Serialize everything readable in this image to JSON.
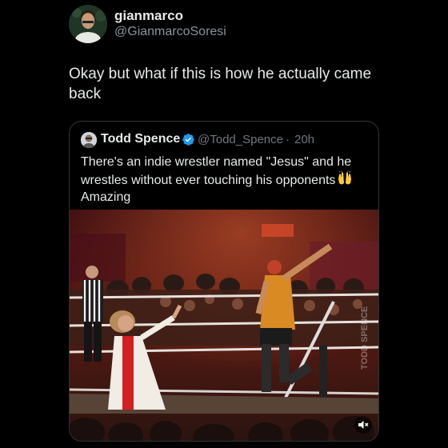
{
  "author": {
    "name": "gianmarco",
    "handle": "@GianmarcoSoresi",
    "avatar_icon": "profile-photo"
  },
  "tweet": {
    "text_line1": "Okay but what if this is how he actually came",
    "text_line2": "back"
  },
  "quote": {
    "name": "Todd Spence",
    "handle": "@Todd_Spence",
    "separator": "·",
    "time": "20h",
    "verified_color": "#1d9bf0",
    "text_line1": "There's an indie wrestler named \"Jesus\" and he",
    "text_line2": "wrestles without ever touching his opponents",
    "emoji_icon": "raising-hands-emoji",
    "text_line3": "Amazing",
    "media": {
      "type": "video",
      "watermark": "TODD SPENCE",
      "audio_icon": "mute-icon"
    }
  },
  "colors": {
    "background": "#000000",
    "primary_text": "#e7e9ea",
    "secondary_text": "#71767b",
    "border": "#2f3336"
  }
}
